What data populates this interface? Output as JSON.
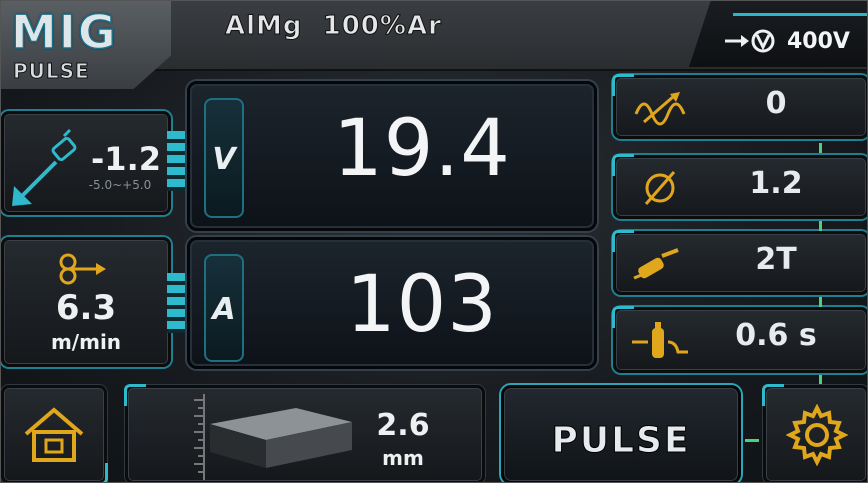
{
  "header": {
    "mode_main": "MIG",
    "mode_sub": "PULSE",
    "material": "AlMg  100%Ar",
    "voltage": "400V"
  },
  "main": {
    "voltage_unit": "V",
    "voltage_value": "19.4",
    "current_unit": "A",
    "current_value": "103"
  },
  "left": {
    "arc_correction": {
      "value": "-1.2",
      "range": "-5.0~+5.0"
    },
    "wire_speed": {
      "value": "6.3",
      "unit": "m/min"
    }
  },
  "right": {
    "items": [
      {
        "icon": "arc-length-icon",
        "value": "0"
      },
      {
        "icon": "diameter-icon",
        "value": "1.2"
      },
      {
        "icon": "torch-icon",
        "value": "2T"
      },
      {
        "icon": "gas-postflow-icon",
        "value": "0.6 s"
      }
    ]
  },
  "bottom": {
    "thickness_value": "2.6",
    "thickness_unit": "mm",
    "pulse_label": "PULSE"
  },
  "colors": {
    "accent": "#2fb9cc",
    "icon_gold": "#e0a61c",
    "text": "#eef0f2"
  }
}
